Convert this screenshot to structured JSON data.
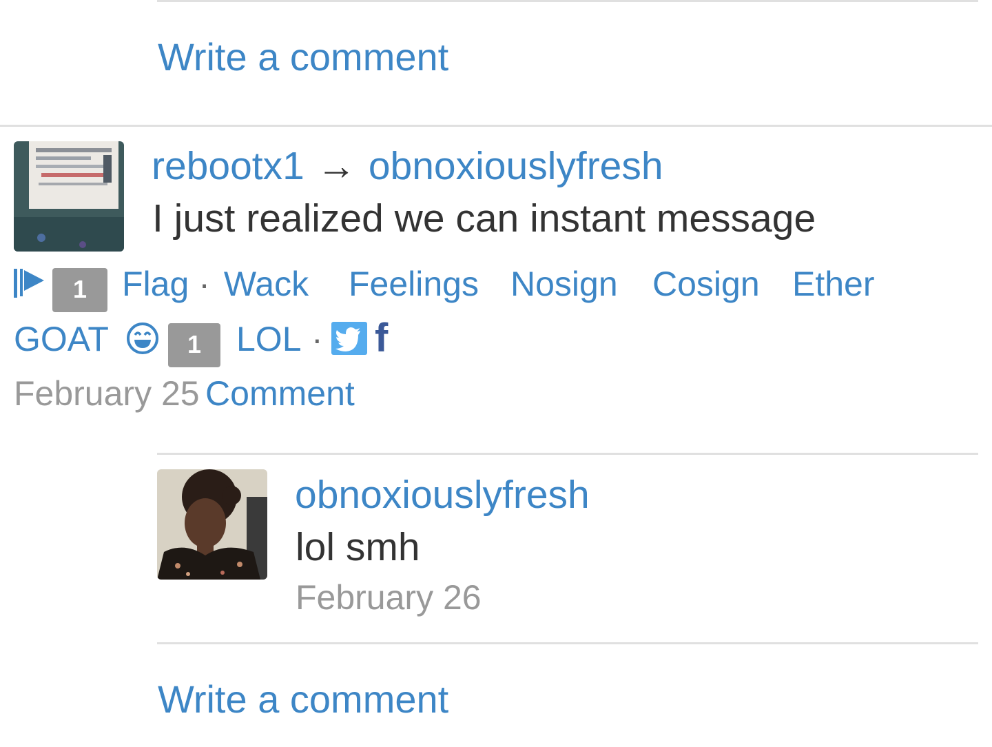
{
  "thread_top": {
    "write_comment": "Write a comment"
  },
  "post": {
    "author": "rebootx1",
    "arrow": "→",
    "recipient": "obnoxiouslyfresh",
    "message": "I just realized we can instant message",
    "flag_count": "1",
    "actions": {
      "flag": "Flag",
      "sep1": "·",
      "wack": "Wack",
      "feelings": "Feelings",
      "nosign": "Nosign",
      "cosign": "Cosign",
      "ether": "Ether",
      "goat": "GOAT",
      "lol_count": "1",
      "lol": "LOL",
      "sep2": "·",
      "facebook": "f"
    },
    "date": "February 25",
    "comment_link": "Comment"
  },
  "reply": {
    "author": "obnoxiouslyfresh",
    "message": "lol smh",
    "date": "February 26"
  },
  "thread_bottom": {
    "write_comment": "Write a comment"
  },
  "colors": {
    "link": "#3d86c6",
    "muted": "#999999",
    "text": "#333333",
    "divider": "#e0e0e0"
  },
  "icons": {
    "flag": "flag-icon",
    "lol": "laughing-face-icon",
    "twitter": "twitter-icon",
    "facebook": "facebook-icon"
  }
}
